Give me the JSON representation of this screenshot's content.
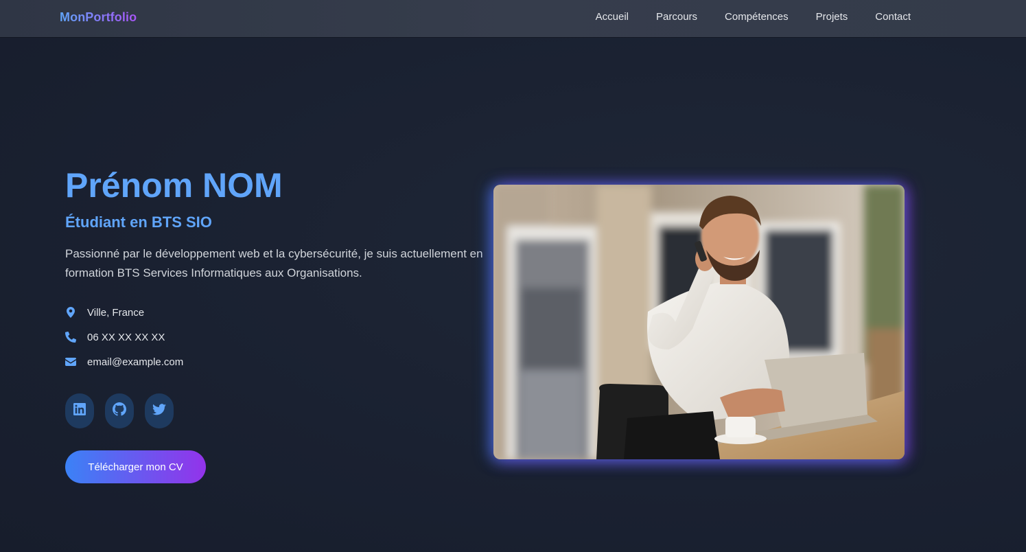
{
  "navbar": {
    "logo": "MonPortfolio",
    "links": [
      "Accueil",
      "Parcours",
      "Compétences",
      "Projets",
      "Contact"
    ]
  },
  "hero": {
    "name": "Prénom NOM",
    "subtitle": "Étudiant en BTS SIO",
    "description": "Passionné par le développement web et la cybersécurité, je suis actuellement en formation BTS Services Informatiques aux Organisations.",
    "contacts": [
      {
        "icon": "map-pin-icon",
        "text": "Ville, France"
      },
      {
        "icon": "phone-icon",
        "text": "06 XX XX XX XX"
      },
      {
        "icon": "envelope-icon",
        "text": "email@example.com"
      }
    ],
    "socials": [
      "linkedin-icon",
      "github-icon",
      "twitter-icon"
    ],
    "cv_button": "Télécharger mon CV",
    "image_alt": "photo-man-on-phone-with-laptop"
  },
  "colors": {
    "accent_blue": "#60a5fa",
    "accent_purple": "#9333ea",
    "background": "#1b2233",
    "navbar": "#343b4a"
  }
}
